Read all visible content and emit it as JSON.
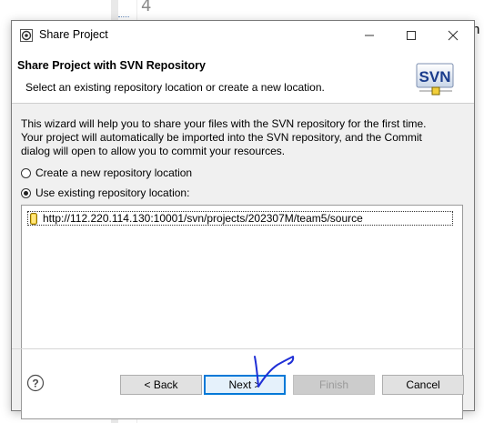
{
  "background": {
    "line_number": "4",
    "partial_text": "n"
  },
  "window": {
    "title": "Share Project",
    "icons": {
      "app": "eclipse-icon",
      "minimize": "minimize-icon",
      "maximize": "maximize-icon",
      "close": "close-icon"
    }
  },
  "banner": {
    "title": "Share Project with SVN Repository",
    "description": "Select an existing repository location or create a new location.",
    "logo_text": "SVN"
  },
  "content": {
    "intro_lines": [
      "This wizard will help you to share your files with the SVN repository for the first time.",
      "Your project will automatically be imported into the SVN repository, and the Commit",
      "dialog will open to allow you to commit your resources."
    ],
    "option_create": "Create a new repository location",
    "option_existing": "Use existing repository location:",
    "selected_option": "existing",
    "repositories": [
      {
        "url": "http://112.220.114.130:10001/svn/projects/202307M/team5/source",
        "icon": "repository-icon"
      }
    ]
  },
  "footer": {
    "help_icon": "help-icon",
    "back_label": "< Back",
    "next_label": "Next >",
    "finish_label": "Finish",
    "cancel_label": "Cancel"
  },
  "colors": {
    "focus_border": "#0078d7",
    "dialog_bg": "#f0f0f0",
    "annotation_ink": "#1f2fd6"
  }
}
